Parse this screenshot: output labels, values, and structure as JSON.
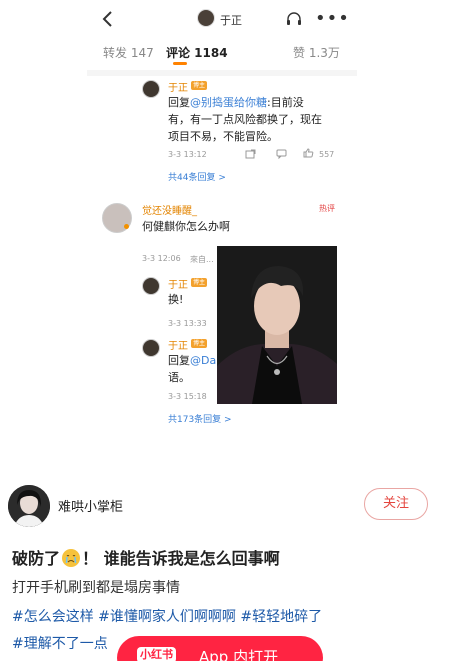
{
  "weibo": {
    "author_name": "于正",
    "tabs": {
      "repost": "转发 147",
      "comment": "评论 1184",
      "like": "赞 1.3万"
    },
    "comments": [
      {
        "user": "于正",
        "badge": "博主",
        "reply_prefix": "回复",
        "mention": "@别捣蛋给你糖",
        "text_lines": [
          ":目前没",
          "有，有一丁点风险都换了，现在",
          "项目不易，不能冒险。"
        ],
        "time": "3-3 13:12",
        "likes": "557",
        "more": "共44条回复 >"
      },
      {
        "user": "觉还没睡醒_",
        "tag": "热评",
        "text": "何健麒你怎么办啊",
        "time": "3-3 12:06",
        "time_suffix": "來自..."
      },
      {
        "user": "于正",
        "badge": "博主",
        "text": "换!",
        "time": "3-3 13:33"
      },
      {
        "user": "于正",
        "badge": "博主",
        "reply_prefix": "回复",
        "mention": "@Da",
        "text_line2": "语。",
        "time": "3-3 15:18",
        "more": "共173条回复 >"
      }
    ]
  },
  "post": {
    "username": "难哄小掌柜",
    "follow_label": "关注",
    "title_part1": "破防了",
    "title_part2": "！ 谁能告诉我是怎么回事啊",
    "body": "打开手机刷到都是塌房事情",
    "tags_line1": "#怎么会这样 #谁懂啊家人们啊啊啊 #轻轻地碎了",
    "tags_line2": "#理解不了一点",
    "open_app_logo": "小红书",
    "open_app_label": "App 内打开"
  },
  "colors": {
    "accent": "#ff8200",
    "link": "#3a7fd5",
    "follow": "#e4463f",
    "app_button": "#ff2442"
  }
}
